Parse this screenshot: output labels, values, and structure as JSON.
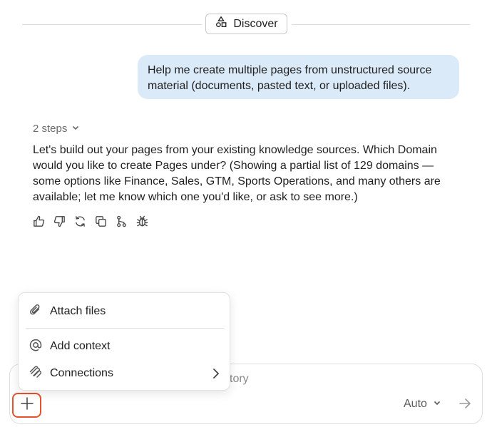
{
  "header": {
    "discover_label": "Discover",
    "discover_icon": "shapes-icon"
  },
  "user_message": {
    "text": "Help me create multiple pages from unstructured source material (documents, pasted text, or uploaded files)."
  },
  "assistant": {
    "steps_label": "2 steps",
    "message": "Let's build out your pages from your existing knowledge sources. Which Domain would you like to create Pages under? (Showing a partial list of 129 domains — some options like Finance, Sales, GTM, Sports Operations, and many others are available; let me know which one you'd like, or ask to see more.)",
    "actions": [
      "thumbs-up-icon",
      "thumbs-down-icon",
      "regenerate-icon",
      "copy-icon",
      "branch-icon",
      "bug-icon"
    ]
  },
  "composer": {
    "placeholder_fragment": "tory",
    "model_label": "Auto",
    "accent_color": "#e5532d"
  },
  "attach_menu": {
    "items": [
      {
        "label": "Attach files",
        "icon": "paperclip-icon"
      },
      {
        "label": "Add context",
        "icon": "at-sign-icon"
      },
      {
        "label": "Connections",
        "icon": "connections-icon"
      }
    ]
  }
}
